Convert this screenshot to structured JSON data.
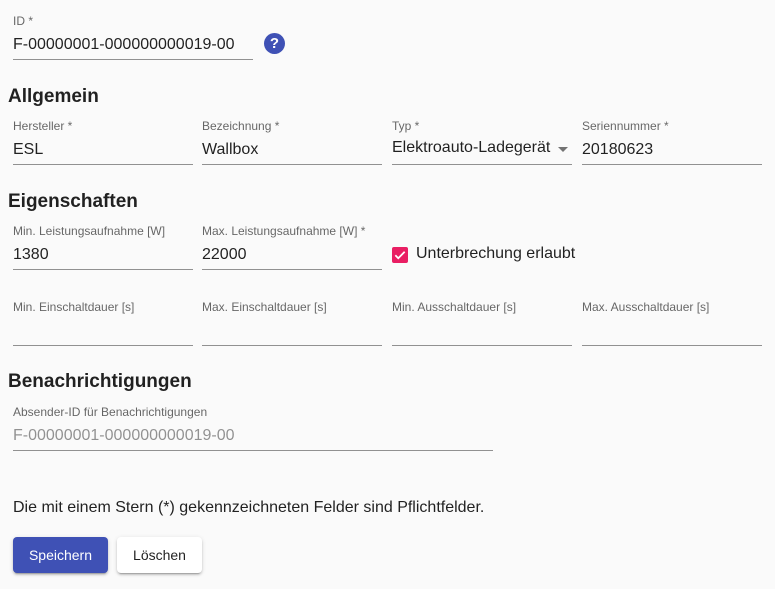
{
  "id_field": {
    "label": "ID *",
    "value": "F-00000001-000000000019-00"
  },
  "help_icon": {
    "name": "help-icon",
    "glyph": "?"
  },
  "sections": {
    "general": "Allgemein",
    "properties": "Eigenschaften",
    "notifications": "Benachrichtigungen"
  },
  "general": {
    "manufacturer": {
      "label": "Hersteller *",
      "value": "ESL"
    },
    "designation": {
      "label": "Bezeichnung *",
      "value": "Wallbox"
    },
    "type": {
      "label": "Typ *",
      "value": "Elektroauto-Ladegerät"
    },
    "serial": {
      "label": "Seriennummer *",
      "value": "20180623"
    }
  },
  "properties": {
    "min_power": {
      "label": "Min. Leistungsaufnahme [W]",
      "value": "1380"
    },
    "max_power": {
      "label": "Max. Leistungsaufnahme [W] *",
      "value": "22000"
    },
    "interruption": {
      "label": "Unterbrechung erlaubt",
      "checked": true
    },
    "min_on": {
      "label": "Min. Einschaltdauer [s]",
      "value": ""
    },
    "max_on": {
      "label": "Max. Einschaltdauer [s]",
      "value": ""
    },
    "min_off": {
      "label": "Min. Ausschaltdauer [s]",
      "value": ""
    },
    "max_off": {
      "label": "Max. Ausschaltdauer [s]",
      "value": ""
    }
  },
  "notifications": {
    "sender_id": {
      "label": "Absender-ID für Benachrichtigungen",
      "placeholder": "F-00000001-000000000019-00"
    }
  },
  "note": "Die mit einem Stern (*) gekennzeichneten Felder sind Pflichtfelder.",
  "buttons": {
    "save": "Speichern",
    "delete": "Löschen"
  },
  "colors": {
    "primary": "#3f51b5",
    "accent": "#e91e63",
    "background": "#fafafa"
  }
}
